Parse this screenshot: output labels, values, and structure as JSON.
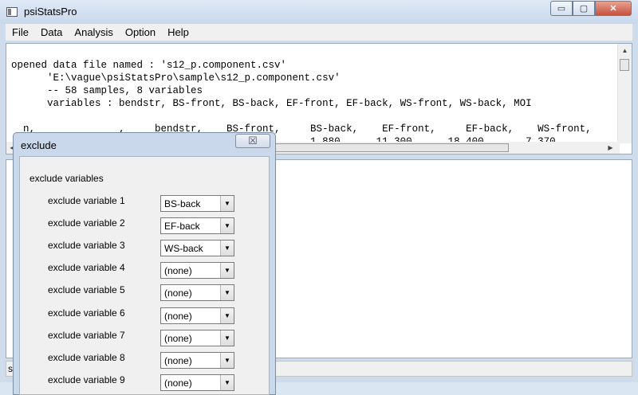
{
  "window": {
    "title": "psiStatsPro",
    "minimize": "▭",
    "maximize": "▢",
    "close": "✕"
  },
  "menu": [
    "File",
    "Data",
    "Analysis",
    "Option",
    "Help"
  ],
  "log": {
    "lines": [
      "opened data file named : 's12_p.component.csv'",
      "      'E:\\vague\\psiStatsPro\\sample\\s12_p.component.csv'",
      "      -- 58 samples, 8 variables",
      "      variables : bendstr, BS-front, BS-back, EF-front, EF-back, WS-front, WS-back, MOI",
      "",
      "  n,              ,     bendstr,    BS-front,     BS-back,    EF-front,     EF-back,    WS-front,",
      "                                        ,00       1.880      11.300      18.400       7.370"
    ]
  },
  "status": {
    "text": "s"
  },
  "dialog": {
    "title": "exclude",
    "close_glyph": "☒",
    "group_label": "exclude variables",
    "rows": [
      {
        "label": "exclude variable 1",
        "value": "BS-back"
      },
      {
        "label": "exclude variable 2",
        "value": "EF-back"
      },
      {
        "label": "exclude variable 3",
        "value": "WS-back"
      },
      {
        "label": "exclude variable 4",
        "value": "(none)"
      },
      {
        "label": "exclude variable 5",
        "value": "(none)"
      },
      {
        "label": "exclude variable 6",
        "value": "(none)"
      },
      {
        "label": "exclude variable 7",
        "value": "(none)"
      },
      {
        "label": "exclude variable 8",
        "value": "(none)"
      },
      {
        "label": "exclude variable 9",
        "value": "(none)"
      }
    ]
  },
  "icons": {
    "combo_arrow": "▼",
    "scroll_up": "▲",
    "scroll_left": "◀",
    "scroll_right": "▶"
  }
}
